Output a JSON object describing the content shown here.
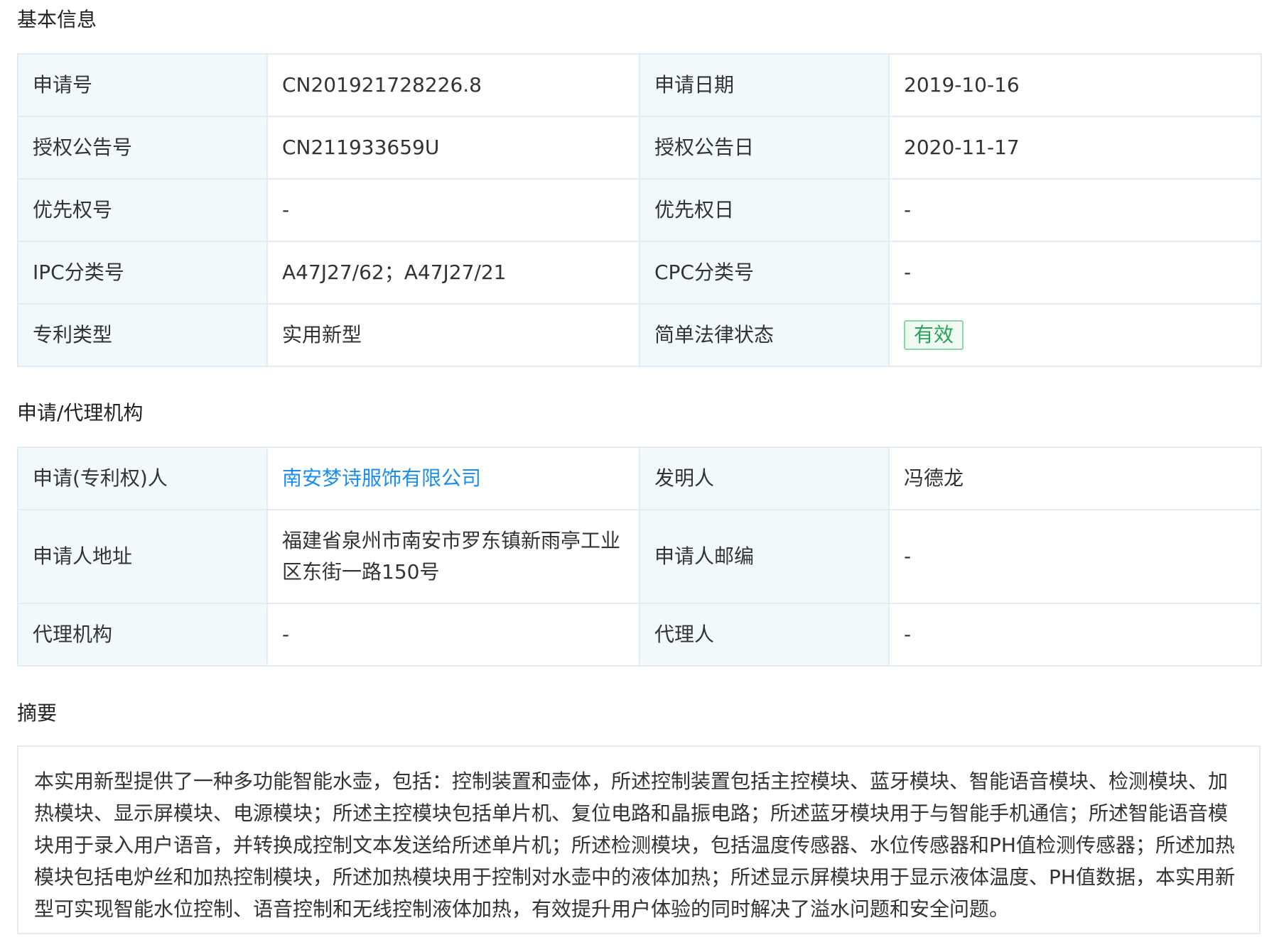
{
  "sections": {
    "basic_info": "基本信息",
    "agency": "申请/代理机构",
    "abstract": "摘要"
  },
  "basic_info": [
    {
      "label1": "申请号",
      "value1": "CN201921728226.8",
      "label2": "申请日期",
      "value2": "2019-10-16"
    },
    {
      "label1": "授权公告号",
      "value1": "CN211933659U",
      "label2": "授权公告日",
      "value2": "2020-11-17"
    },
    {
      "label1": "优先权号",
      "value1": "-",
      "label2": "优先权日",
      "value2": "-"
    },
    {
      "label1": "IPC分类号",
      "value1": "A47J27/62；A47J27/21",
      "label2": "CPC分类号",
      "value2": "-"
    },
    {
      "label1": "专利类型",
      "value1": "实用新型",
      "label2": "简单法律状态",
      "value2": "有效"
    }
  ],
  "agency_info": [
    {
      "label1": "申请(专利权)人",
      "value1": "南安梦诗服饰有限公司",
      "label2": "发明人",
      "value2": "冯德龙"
    },
    {
      "label1": "申请人地址",
      "value1": "福建省泉州市南安市罗东镇新雨亭工业区东街一路150号",
      "label2": "申请人邮编",
      "value2": "-"
    },
    {
      "label1": "代理机构",
      "value1": "-",
      "label2": "代理人",
      "value2": "-"
    }
  ],
  "abstract_text": "本实用新型提供了一种多功能智能水壶，包括：控制装置和壶体，所述控制装置包括主控模块、蓝牙模块、智能语音模块、检测模块、加热模块、显示屏模块、电源模块；所述主控模块包括单片机、复位电路和晶振电路；所述蓝牙模块用于与智能手机通信；所述智能语音模块用于录入用户语音，并转换成控制文本发送给所述单片机；所述检测模块，包括温度传感器、水位传感器和PH值检测传感器；所述加热模块包括电炉丝和加热控制模块，所述加热模块用于控制对水壶中的液体加热；所述显示屏模块用于显示液体温度、PH值数据，本实用新型可实现智能水位控制、语音控制和无线控制液体加热，有效提升用户体验的同时解决了溢水问题和安全问题。",
  "colors": {
    "label_bg": "#f2f9fc",
    "border": "#e4ecf3",
    "link": "#1a8ef0",
    "status_green": "#2aa35a"
  }
}
